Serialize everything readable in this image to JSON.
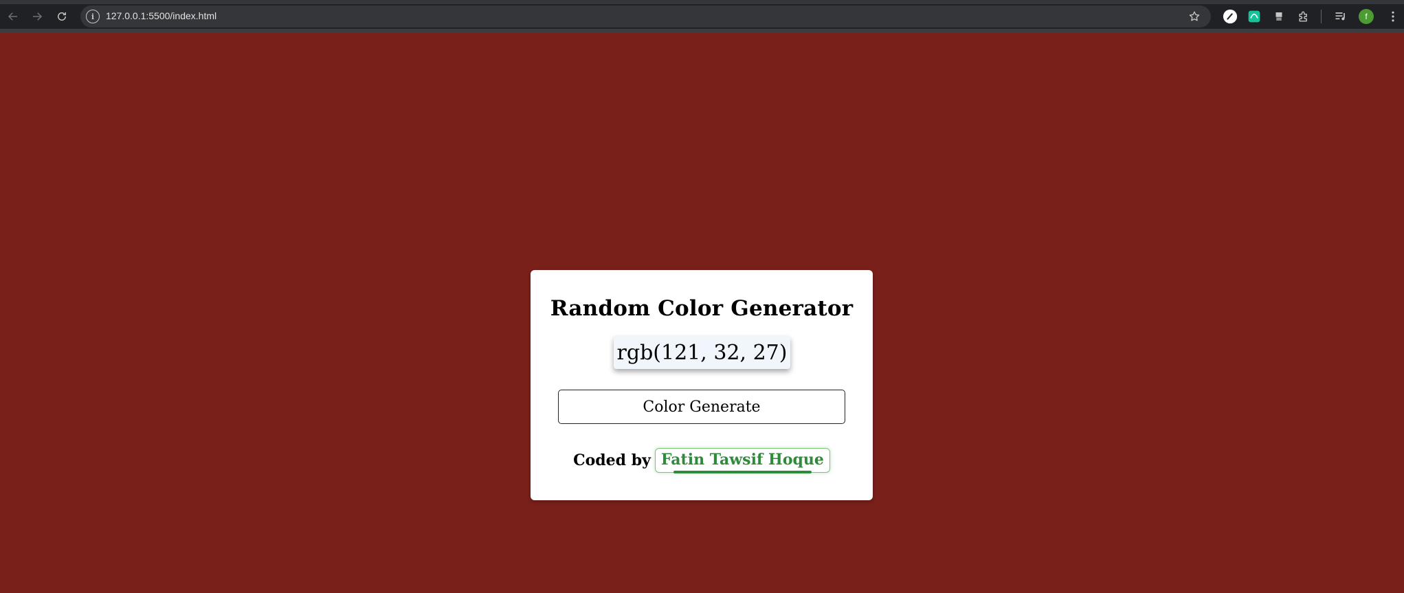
{
  "browser": {
    "url": "127.0.0.1:5500/index.html",
    "site_info_glyph": "i",
    "profile_initial": "f",
    "icons": [
      "back-arrow-icon",
      "forward-arrow-icon",
      "reload-icon",
      "site-info-icon",
      "bookmark-star-icon",
      "extension-icon",
      "extension-icon",
      "extension-icon",
      "extensions-puzzle-icon",
      "media-control-icon",
      "profile-avatar",
      "kebab-menu-icon"
    ]
  },
  "page": {
    "background_color": "#79201b",
    "title": "Random Color Generator",
    "color_code": "rgb(121, 32, 27)",
    "generate_button": "Color Generate",
    "credit_label": "Coded by",
    "author": "Fatin Tawsif Hoque",
    "author_color": "#2e8b3a"
  }
}
